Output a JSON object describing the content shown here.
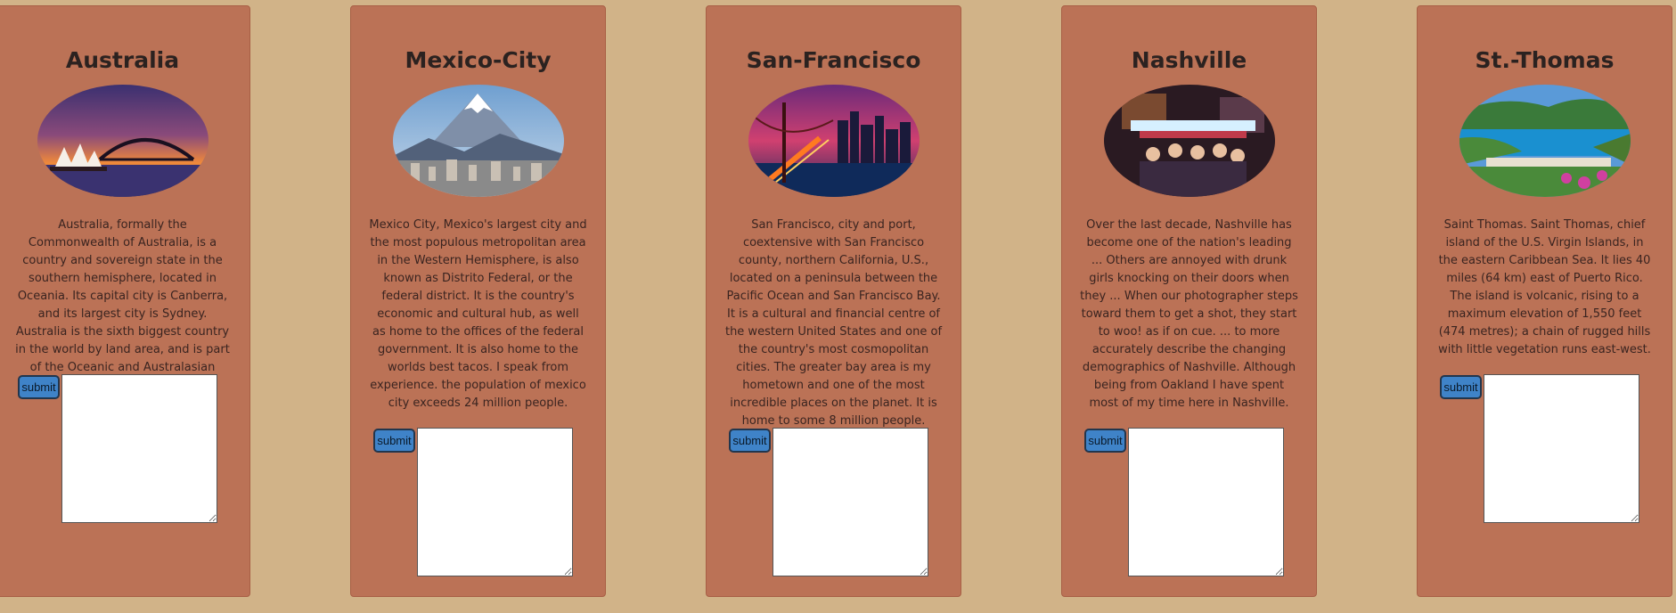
{
  "cards": [
    {
      "title": "Australia",
      "description": "Australia, formally the Commonwealth of Australia, is a country and sovereign state in the southern hemisphere, located in Oceania. Its capital city is Canberra, and its largest city is Sydney. Australia is the sixth biggest country in the world by land area, and is part of the Oceanic and Australasian regions.",
      "submit_label": "submit",
      "textarea_value": ""
    },
    {
      "title": "Mexico-City",
      "description": "Mexico City, Mexico's largest city and the most populous metropolitan area in the Western Hemisphere, is also known as Distrito Federal, or the federal district. It is the country's economic and cultural hub, as well as home to the offices of the federal government. It is also home to the worlds best tacos. I speak from experience. the population of mexico city exceeds 24 million people.",
      "submit_label": "submit",
      "textarea_value": ""
    },
    {
      "title": "San-Francisco",
      "description": "San Francisco, city and port, coextensive with San Francisco county, northern California, U.S., located on a peninsula between the Pacific Ocean and San Francisco Bay. It is a cultural and financial centre of the western United States and one of the country's most cosmopolitan cities. The greater bay area is my hometown and one of the most incredible places on the planet. It is home to some 8 million people.",
      "submit_label": "submit",
      "textarea_value": ""
    },
    {
      "title": "Nashville",
      "description": "Over the last decade, Nashville has become one of the nation's leading ... Others are annoyed with drunk girls knocking on their doors when they ... When our photographer steps toward them to get a shot, they start to woo! as if on cue. ... to more accurately describe the changing demographics of Nashville. Although being from Oakland I have spent most of my time here in Nashville.",
      "submit_label": "submit",
      "textarea_value": ""
    },
    {
      "title": "St.-Thomas",
      "description": "Saint Thomas. Saint Thomas, chief island of the U.S. Virgin Islands, in the eastern Caribbean Sea. It lies 40 miles (64 km) east of Puerto Rico. The island is volcanic, rising to a maximum elevation of 1,550 feet (474 metres); a chain of rugged hills with little vegetation runs east-west.",
      "submit_label": "submit",
      "textarea_value": ""
    }
  ],
  "colors": {
    "page_background": "#d1b388",
    "card_background": "#bb7256",
    "button_background": "#3f83c8"
  }
}
